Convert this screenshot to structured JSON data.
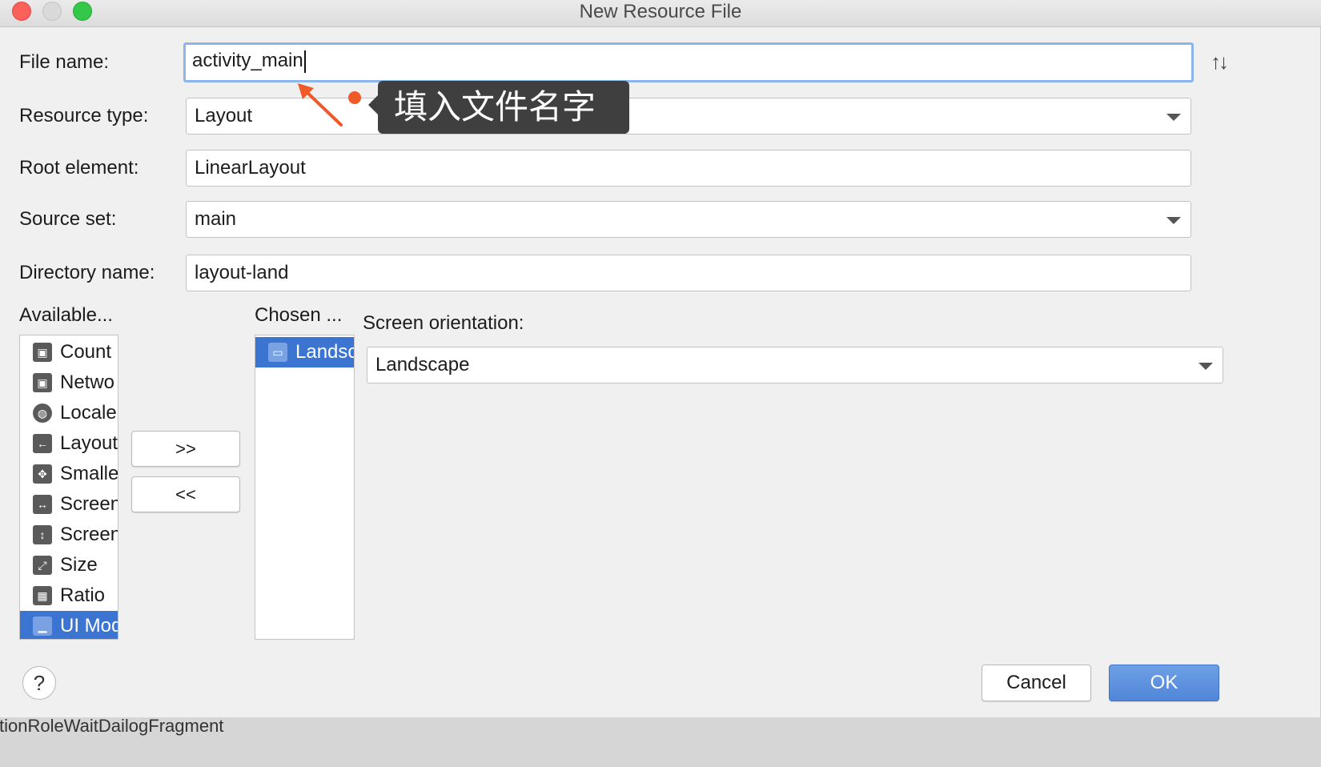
{
  "window": {
    "title": "New Resource File"
  },
  "form": {
    "file_name_label": "File name:",
    "file_name_value": "activity_main",
    "resource_type_label": "Resource type:",
    "resource_type_value": "Layout",
    "root_element_label": "Root element:",
    "root_element_value": "LinearLayout",
    "source_set_label": "Source set:",
    "source_set_value": "main",
    "directory_name_label": "Directory name:",
    "directory_name_value": "layout-land"
  },
  "qualifiers": {
    "available_label": "Available...",
    "chosen_label": "Chosen ...",
    "available_items": [
      {
        "label": "Count",
        "icon": "country-code-icon"
      },
      {
        "label": "Netwo",
        "icon": "network-code-icon"
      },
      {
        "label": "Locale",
        "icon": "globe-icon"
      },
      {
        "label": "Layout",
        "icon": "layout-direction-icon"
      },
      {
        "label": "Smalle",
        "icon": "smallest-width-icon"
      },
      {
        "label": "Screen",
        "icon": "screen-width-icon"
      },
      {
        "label": "Screen",
        "icon": "screen-height-icon"
      },
      {
        "label": "Size",
        "icon": "size-icon"
      },
      {
        "label": "Ratio",
        "icon": "ratio-icon"
      },
      {
        "label": "UI Mod",
        "icon": "ui-mode-icon"
      }
    ],
    "chosen_items": [
      {
        "label": "Landsc",
        "icon": "orientation-icon"
      }
    ],
    "add_button": ">>",
    "remove_button": "<<",
    "screen_orientation_label": "Screen orientation:",
    "screen_orientation_value": "Landscape"
  },
  "buttons": {
    "cancel": "Cancel",
    "ok": "OK",
    "help": "?"
  },
  "annotation": {
    "tooltip_text": "填入文件名字",
    "accent_color": "#f05a28"
  },
  "background": {
    "strip_text": "ctionRoleWaitDailogFragment"
  }
}
